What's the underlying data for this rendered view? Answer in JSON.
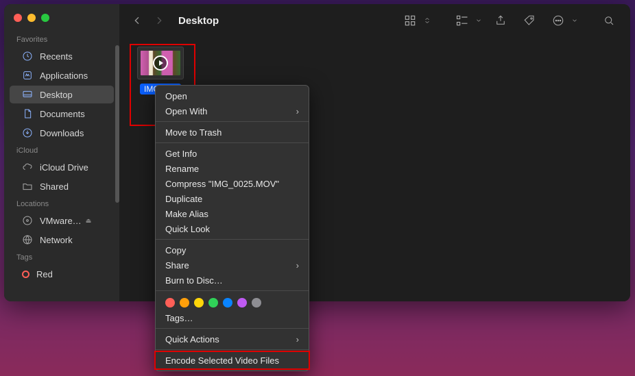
{
  "window": {
    "title": "Desktop"
  },
  "sidebar": {
    "sections": {
      "favorites": {
        "title": "Favorites",
        "items": [
          "Recents",
          "Applications",
          "Desktop",
          "Documents",
          "Downloads"
        ]
      },
      "icloud": {
        "title": "iCloud",
        "items": [
          "iCloud Drive",
          "Shared"
        ]
      },
      "locations": {
        "title": "Locations",
        "items": [
          "VMware…",
          "Network"
        ]
      },
      "tags": {
        "title": "Tags",
        "items": [
          "Red"
        ]
      }
    },
    "active": "Desktop"
  },
  "file": {
    "label": "IMG_0…"
  },
  "context_menu": {
    "items": {
      "open": "Open",
      "open_with": "Open With",
      "move_to_trash": "Move to Trash",
      "get_info": "Get Info",
      "rename": "Rename",
      "compress": "Compress \"IMG_0025.MOV\"",
      "duplicate": "Duplicate",
      "make_alias": "Make Alias",
      "quick_look": "Quick Look",
      "copy": "Copy",
      "share": "Share",
      "burn": "Burn to Disc…",
      "tags": "Tags…",
      "quick_actions": "Quick Actions",
      "encode": "Encode Selected Video Files"
    },
    "tag_colors": [
      "#ff5f57",
      "#ff9f0a",
      "#ffd60a",
      "#30d158",
      "#0a84ff",
      "#bf5af2",
      "#8e8e93"
    ]
  }
}
